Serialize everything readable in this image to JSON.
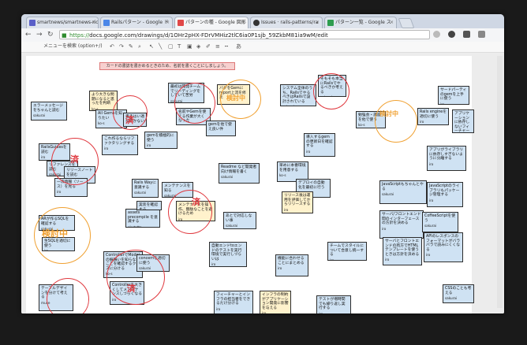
{
  "tabs": [
    {
      "label": "smartnews/smartnews-ric",
      "color": "#5a5fc8"
    },
    {
      "label": "Railsパターン - Google ド",
      "color": "#4a86e8"
    },
    {
      "label": "パターンの種 - Google 図形",
      "color": "#e04848"
    },
    {
      "label": "Issues · rails-patterns/ra",
      "color": "#333333"
    },
    {
      "label": "パターン一覧 - Google ス",
      "color": "#2e9d4f"
    }
  ],
  "url": {
    "scheme": "https://",
    "rest": "docs.google.com/drawings/d/1OHr2pHX-FDrVMHiz2tlC6ia0P1sjb_59ZkbM81ia9wM/edit"
  },
  "toolbar": {
    "menu_search": "メニューを検索 (option+/)"
  },
  "banner": "カードの書誌を書かめるときのため、名前を書くことにしましょう。",
  "stamps": {
    "done": "済",
    "in_progress": "検討中",
    "executing": "検討中"
  },
  "cards": [
    {
      "id": "error-message",
      "text": "エラーメッセージをちゃんと読む",
      "owner": "sakurai",
      "y": false
    },
    {
      "id": "too-many-problems",
      "text": "より大きな問題になると思ったを判断",
      "owner": "ko-s",
      "y": true
    },
    {
      "id": "all-gems",
      "text": "All Gemsを知りたい",
      "owner": "ko-s",
      "y": false
    },
    {
      "id": "no-wish",
      "text": "書きはい適なのかない",
      "owner": "",
      "y": false
    },
    {
      "id": "reading-team",
      "text": "最初は開発チームでリーディングをしていて苦労",
      "owner": "sakurai",
      "y": false
    },
    {
      "id": "bug-gem",
      "text": "バグをGemにreport上流を修正",
      "owner": "",
      "y": true
    },
    {
      "id": "rails-scaling",
      "text": "システム全体のうち、RailsでやるべきはRailsで設計されている",
      "owner": "sakurai",
      "y": false
    },
    {
      "id": "rails-tech",
      "text": "そもそも本当にRailsでやるべきか考える",
      "owner": "sakurai",
      "y": false
    },
    {
      "id": "service-class",
      "text": "サードパーティのgemを上手に使う",
      "owner": "iro",
      "y": false
    },
    {
      "id": "gem-maintain",
      "text": "名前やGemを使える作業が大くなった",
      "owner": "sakurai",
      "y": false
    },
    {
      "id": "gem-read",
      "text": "gemを他で使え良い件",
      "owner": "",
      "y": false
    },
    {
      "id": "gem-refactor",
      "text": "gemを積極的に使う",
      "owner": "iro",
      "y": false
    },
    {
      "id": "review-needed",
      "text": "勉強会・講座を他で使う",
      "owner": "ko-s",
      "y": false
    },
    {
      "id": "rails-engine",
      "text": "Rails engineを適切に使う",
      "owner": "iro",
      "y": false
    },
    {
      "id": "no-app-gem",
      "text": "アプリケーションに依存しないフィーチャーはgemにする",
      "owner": "sakurai",
      "y": false
    },
    {
      "id": "rails-guide",
      "text": "RailsGuidesを読む",
      "owner": "iro",
      "y": false
    },
    {
      "id": "reference",
      "text": "リファレンスを読む",
      "owner": "sakurai",
      "y": false
    },
    {
      "id": "release-notes",
      "text": "リリースノートを読む",
      "owner": "iro",
      "y": false
    },
    {
      "id": "refactor-more",
      "text": "これ作るならリファクタリングする",
      "owner": "iro",
      "y": false
    },
    {
      "id": "gem-mvp",
      "text": "導入するgemの更新日を確認する",
      "owner": "iro",
      "y": false
    },
    {
      "id": "library-split",
      "text": "アプリがライブラリに依存しすぎないように分離する",
      "owner": "iro",
      "y": false
    },
    {
      "id": "rails-way",
      "text": "Rails Wayに意識する",
      "owner": "sakurai",
      "y": false
    },
    {
      "id": "read-code",
      "text": "メンテナンスを知る",
      "owner": "sakurai",
      "y": false
    },
    {
      "id": "readme-basics",
      "text": "Readme など開発者向け情報を書く",
      "owner": "sakurai",
      "y": false
    },
    {
      "id": "wiki",
      "text": "早めに本番環境を用意する",
      "owner": "ko-s",
      "y": false
    },
    {
      "id": "auto-deploy",
      "text": "デプロイの自動化を最初に行う",
      "owner": "iro",
      "y": false
    },
    {
      "id": "js-mvc",
      "text": "JavaScriptもちゃんとやる",
      "owner": "sakurai",
      "y": false
    },
    {
      "id": "js-library",
      "text": "JavaScriptのライブラリもパッケージ管理する",
      "owner": "iro",
      "y": false
    },
    {
      "id": "ask-dev",
      "text": "一次情報（ソース）を見る",
      "owner": "iro",
      "y": false
    },
    {
      "id": "keep-maintain",
      "text": "メンテナンスを操作、無駄なことを避けるため",
      "owner": "iro",
      "y": true
    },
    {
      "id": "check-jobs",
      "text": "リリース後は運用を評価してからリリースする",
      "owner": "iro",
      "y": true
    },
    {
      "id": "assets-precompile",
      "text": "assets precompile を意識する",
      "owner": "okutatto",
      "y": false
    },
    {
      "id": "fix-later",
      "text": "あとで対応しない事",
      "owner": "sakurai",
      "y": false
    },
    {
      "id": "confirm-impl",
      "text": "実装を確認する",
      "owner": "",
      "y": false
    },
    {
      "id": "frontend-backend",
      "text": "サーバ/フロントエンド間のインターフェースの方針を決める",
      "owner": "iro",
      "y": false
    },
    {
      "id": "coffee",
      "text": "CoffeeScriptを使う",
      "owner": "sakurai",
      "y": false
    },
    {
      "id": "sql-write",
      "text": "ARが作るSQLを確認する",
      "owner": "sakurai",
      "y": false
    },
    {
      "id": "sql-check",
      "text": "生SQLを適切に使う",
      "owner": "iro",
      "y": false
    },
    {
      "id": "controller-model",
      "text": "ControllerでModelの振舞いを知らないことを確認するクラスに分ける",
      "owner": "ko-s",
      "y": false
    },
    {
      "id": "concern",
      "text": "concernを適切に使う",
      "owner": "sakurai",
      "y": false
    },
    {
      "id": "e2e-test",
      "text": "自動エンドtoエンドのテストを実行環境で実行しづらいは",
      "owner": "iro",
      "y": false
    },
    {
      "id": "team-style",
      "text": "チームでスタイルについて合意し統一する",
      "owner": "iro",
      "y": false
    },
    {
      "id": "html-mvc",
      "text": "サーバとフロントエンドの両方でHTMLテンプレートを使うときは方針を決める",
      "owner": "iro",
      "y": false
    },
    {
      "id": "api-response",
      "text": "APIのレスポンスのフォーマットがバラバラで読みにくくなる",
      "owner": "iro",
      "y": false
    },
    {
      "id": "table-design",
      "text": "テーブルデザインを分けて考える",
      "owner": "muse",
      "y": false
    },
    {
      "id": "controller-model-2",
      "text": "Controllerを大きくしてメンテナンスしづらくなる",
      "owner": "iro",
      "y": false
    },
    {
      "id": "metrics",
      "text": "機能に合わせることにまとめる",
      "owner": "iro",
      "y": false
    },
    {
      "id": "feature-e2e",
      "text": "フィーチャーとインフラの担当者をできるだけ分ける",
      "owner": "iro",
      "y": false
    },
    {
      "id": "infra-team",
      "text": "インフラの制約がアプリケーション開発に影響を与える",
      "owner": "iro",
      "y": true
    },
    {
      "id": "test-speed",
      "text": "テストが増時間でも繰り返し実行する",
      "owner": "iro",
      "y": false
    },
    {
      "id": "css-think",
      "text": "CSSのことも考える",
      "owner": "sakurai",
      "y": false
    }
  ]
}
